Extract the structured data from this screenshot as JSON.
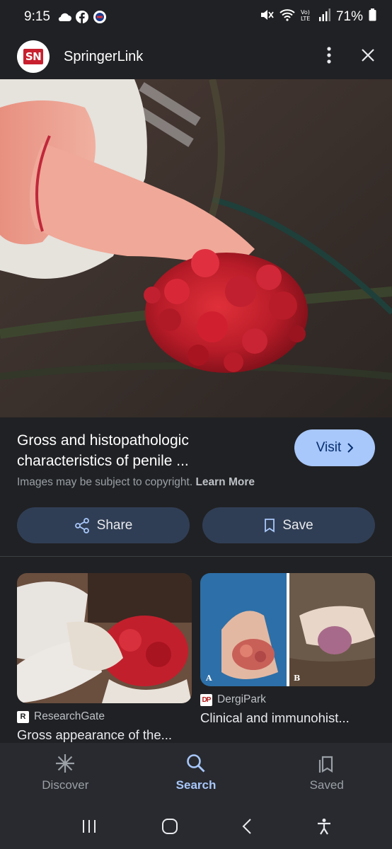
{
  "status": {
    "time": "9:15",
    "battery": "71%"
  },
  "header": {
    "site_name": "SpringerLink",
    "logo_text": "SN"
  },
  "result": {
    "title_line1": "Gross and histopathologic",
    "title_line2": "characteristics of penile ...",
    "visit_label": "Visit",
    "copyright_text": "Images may be subject to copyright.",
    "learn_more_label": "Learn More",
    "share_label": "Share",
    "save_label": "Save"
  },
  "related": [
    {
      "source": "ResearchGate",
      "favicon": "R",
      "caption": "Gross appearance of the..."
    },
    {
      "source": "DergiPark",
      "favicon": "DP",
      "caption": "Clinical and immunohist...",
      "panel_a": "A",
      "panel_b": "B"
    }
  ],
  "bottom_nav": {
    "discover": "Discover",
    "search": "Search",
    "saved": "Saved"
  },
  "colors": {
    "background": "#202124",
    "accent": "#a8c7fa",
    "pill": "#303e55"
  }
}
